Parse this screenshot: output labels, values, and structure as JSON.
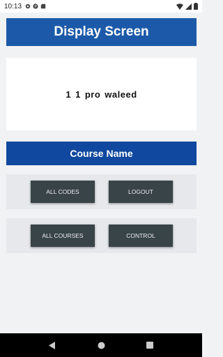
{
  "status_bar": {
    "time": "10:13",
    "left_icons": [
      "gear-icon",
      "p-icon",
      "sd-card-icon"
    ],
    "right_icons": [
      "wifi-icon",
      "signal-icon",
      "battery-icon"
    ]
  },
  "header": {
    "title": "Display Screen"
  },
  "display": {
    "parts": [
      "1",
      "1",
      "pro",
      "waleed"
    ]
  },
  "course": {
    "label": "Course Name"
  },
  "buttons": {
    "all_codes": "ALL CODES",
    "logout": "LOGOUT",
    "all_courses": "ALL COURSES",
    "control": "CONTROL"
  },
  "nav": [
    "back-icon",
    "home-icon",
    "recents-icon"
  ],
  "colors": {
    "header_bg": "#1c5aa9",
    "course_bar_bg": "#10489f",
    "button_bg": "#394449",
    "page_bg": "#f1f2f4"
  }
}
